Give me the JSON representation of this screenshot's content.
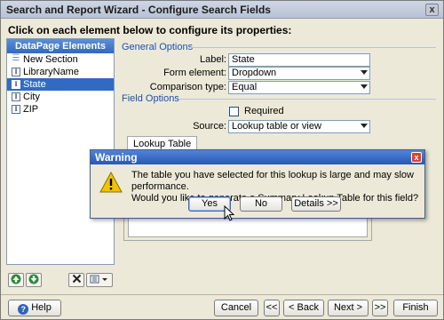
{
  "window": {
    "title": "Search and Report Wizard - Configure Search Fields",
    "close_glyph": "x"
  },
  "instruction": "Click on each element below to configure its properties:",
  "left_panel": {
    "header": "DataPage Elements",
    "items": [
      {
        "label": "New Section",
        "icon": "section-icon",
        "selected": false
      },
      {
        "label": "LibraryName",
        "icon": "field-icon",
        "selected": false
      },
      {
        "label": "State",
        "icon": "field-icon",
        "selected": true
      },
      {
        "label": "City",
        "icon": "field-icon",
        "selected": false
      },
      {
        "label": "ZIP",
        "icon": "field-icon",
        "selected": false
      }
    ],
    "toolbar": {
      "move_up_icon": "arrow-up-icon",
      "move_down_icon": "arrow-down-icon",
      "delete_icon": "delete-x-icon",
      "add_icon": "add-element-icon"
    }
  },
  "general_options": {
    "heading": "General Options",
    "label_caption": "Label:",
    "label_value": "State",
    "form_element_caption": "Form element:",
    "form_element_value": "Dropdown",
    "comparison_caption": "Comparison type:",
    "comparison_value": "Equal"
  },
  "field_options": {
    "heading": "Field Options",
    "required_label": "Required",
    "required_checked": false,
    "source_caption": "Source:",
    "source_value": "Lookup table or view",
    "tab_label": "Lookup Table"
  },
  "bottom_bar": {
    "help": "Help",
    "cancel": "Cancel",
    "first": "<<",
    "back": "< Back",
    "next": "Next >",
    "last": ">>",
    "finish": "Finish"
  },
  "dialog": {
    "title": "Warning",
    "close_glyph": "x",
    "message_line1": "The table you have selected for this lookup is large and may slow performance.",
    "message_line2": "Would you like to generate a Summary Lookup Table for this field?",
    "yes": "Yes",
    "no": "No",
    "details": "Details >>"
  },
  "colors": {
    "selection": "#316ac5",
    "heading_blue": "#1c4fb3",
    "dialog_title": "#2858b5",
    "warning_yellow": "#f2c200"
  }
}
